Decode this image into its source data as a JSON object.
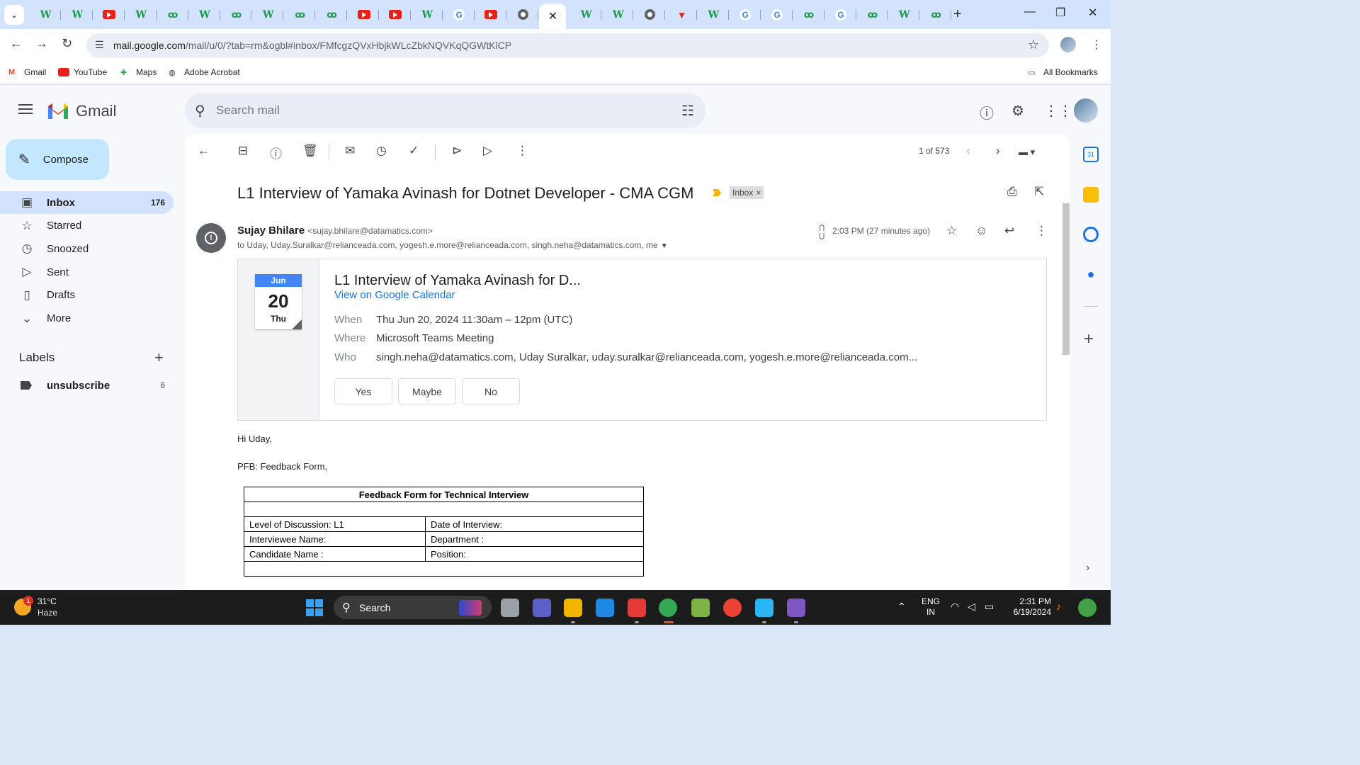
{
  "browser": {
    "tabs": [
      {
        "icon": "wikipedia-icon",
        "glyph": "W"
      },
      {
        "icon": "wikipedia-icon",
        "glyph": "W"
      },
      {
        "icon": "youtube-icon",
        "glyph": ""
      },
      {
        "icon": "wikipedia-icon",
        "glyph": "W"
      },
      {
        "icon": "link-icon",
        "glyph": "ꝏ"
      },
      {
        "icon": "wikipedia-icon",
        "glyph": "W"
      },
      {
        "icon": "link-icon",
        "glyph": "ꝏ"
      },
      {
        "icon": "wikipedia-icon",
        "glyph": "W"
      },
      {
        "icon": "link-icon",
        "glyph": "ꝏ"
      },
      {
        "icon": "link-icon",
        "glyph": "ꝏ"
      },
      {
        "icon": "youtube-icon",
        "glyph": ""
      },
      {
        "icon": "youtube-icon",
        "glyph": ""
      },
      {
        "icon": "wikipedia-icon",
        "glyph": "W"
      },
      {
        "icon": "google-icon",
        "glyph": "G"
      },
      {
        "icon": "youtube-icon",
        "glyph": ""
      },
      {
        "icon": "chrome-icon",
        "glyph": ""
      },
      {
        "icon": "active-tab-close-icon",
        "glyph": "✕",
        "active": true
      },
      {
        "icon": "wikipedia-icon",
        "glyph": "W"
      },
      {
        "icon": "wikipedia-icon",
        "glyph": "W"
      },
      {
        "icon": "chrome-icon",
        "glyph": ""
      },
      {
        "icon": "red-v-icon",
        "glyph": "▼"
      },
      {
        "icon": "wikipedia-icon",
        "glyph": "W"
      },
      {
        "icon": "google-icon",
        "glyph": "G"
      },
      {
        "icon": "google-icon",
        "glyph": "G"
      },
      {
        "icon": "link-icon",
        "glyph": "ꝏ"
      },
      {
        "icon": "google-icon",
        "glyph": "G"
      },
      {
        "icon": "link-icon",
        "glyph": "ꝏ"
      },
      {
        "icon": "wikipedia-icon",
        "glyph": "W"
      },
      {
        "icon": "link-icon",
        "glyph": "ꝏ"
      }
    ],
    "url_host": "mail.google.com",
    "url_path": "/mail/u/0/?tab=rm&ogbl#inbox/FMfcgzQVxHbjkWLcZbkNQVKqQGWtKlCP",
    "bookmarks": [
      {
        "label": "Gmail",
        "icon": "gmail-icon"
      },
      {
        "label": "YouTube",
        "icon": "youtube-icon"
      },
      {
        "label": "Maps",
        "icon": "maps-icon"
      },
      {
        "label": "Adobe Acrobat",
        "icon": "globe-icon"
      }
    ],
    "all_bookmarks": "All Bookmarks"
  },
  "gmail": {
    "app_name": "Gmail",
    "search_placeholder": "Search mail",
    "compose": "Compose",
    "nav": [
      {
        "label": "Inbox",
        "count": "176",
        "icon": "inbox-icon",
        "active": true
      },
      {
        "label": "Starred",
        "count": "",
        "icon": "star-icon"
      },
      {
        "label": "Snoozed",
        "count": "",
        "icon": "clock-icon"
      },
      {
        "label": "Sent",
        "count": "",
        "icon": "send-icon"
      },
      {
        "label": "Drafts",
        "count": "",
        "icon": "draft-icon"
      },
      {
        "label": "More",
        "count": "",
        "icon": "chevron-down-icon"
      }
    ],
    "labels_heading": "Labels",
    "labels": [
      {
        "label": "unsubscribe",
        "count": "6"
      }
    ],
    "pager": "1 of 573"
  },
  "email": {
    "subject": "L1 Interview of Yamaka Avinash for Dotnet Developer - CMA CGM",
    "chip": "Inbox",
    "chip_close": "×",
    "sender_name": "Sujay Bhilare",
    "sender_email": "<sujay.bhilare@datamatics.com>",
    "recipients": "to Uday, Uday.Suralkar@relianceada.com, yogesh.e.more@relianceada.com, singh.neha@datamatics.com, me",
    "time": "2:03 PM (27 minutes ago)",
    "invite": {
      "month": "Jun",
      "day": "20",
      "weekday": "Thu",
      "title": "L1 Interview of Yamaka Avinash for D...",
      "calendar_link": "View on Google Calendar",
      "when_label": "When",
      "when": "Thu Jun 20, 2024 11:30am – 12pm (UTC)",
      "where_label": "Where",
      "where": "Microsoft Teams Meeting",
      "who_label": "Who",
      "who": "singh.neha@datamatics.com, Uday Suralkar, uday.suralkar@relianceada.com, yogesh.e.more@relianceada.com...",
      "yes": "Yes",
      "maybe": "Maybe",
      "no": "No"
    },
    "greeting": "Hi Uday,",
    "pfb": "PFB: Feedback Form,",
    "table": {
      "title": "Feedback Form for Technical Interview",
      "rows": [
        [
          "Level of Discussion: L1",
          "Date of Interview:"
        ],
        [
          "Interviewee Name:",
          "Department :"
        ],
        [
          "Candidate Name :",
          "Position:"
        ]
      ]
    }
  },
  "taskbar": {
    "temp": "31°C",
    "condition": "Haze",
    "weather_badge": "1",
    "search": "Search",
    "lang_top": "ENG",
    "lang_bottom": "IN",
    "time": "2:31 PM",
    "date": "6/19/2024"
  },
  "colors": {
    "accent": "#0b57d0",
    "compose_bg": "#c2e7ff",
    "active_nav": "#d3e3fd",
    "calendar_blue": "#4285f4",
    "important": "#f2b600"
  }
}
